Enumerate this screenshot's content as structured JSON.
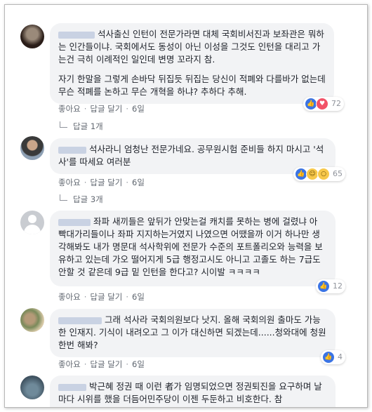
{
  "labels": {
    "like": "좋아요",
    "reply": "답글 달기",
    "sep": "·"
  },
  "comments": [
    {
      "author_name": "",
      "paragraphs": [
        "석사출신 인턴이 전문가라면 대체 국회비서진과 보좌관은 뭐하는 인간들이냐. 국회에서도 동성이 아닌 이성을 그것도 인턴을 대리고 가는건 극히 이례적인 일인데 변명 꼬라지 참.",
        "자기 한말을 그렇게 손바닥 뒤집듯 뒤집는 당신이 적폐와 다를바가 없는데 무슨 적폐를 논하고 무슨 개혁을 하냐? 추하다 추해."
      ],
      "time": "6일",
      "reactions": [
        "like",
        "love"
      ],
      "reaction_count": "72",
      "replies": "답글 1개"
    },
    {
      "author_name": "",
      "paragraphs": [
        "석사라니 엄청난 전문가네요. 공무원시험 준비들 하지 마시고 '석사'를 따세요 여러분"
      ],
      "time": "6일",
      "reactions": [
        "like",
        "haha",
        "wow"
      ],
      "reaction_count": "65",
      "replies": "답글 3개"
    },
    {
      "author_name": "",
      "paragraphs": [
        "좌파 새끼들은 앞뒤가 안맞는걸 캐치를 못하는 병에 걸렸냐 아 빡대가리들이나 좌파 지지하는거였지 나였으면 어땠을까 이거 하나만 생각해봐도 내가 명문대 석사학위에 전문가 수준의 포트폴리오와 능력을 보유하고 있는데 가오 떨어지게 5급 행정고시도 아니고 고졸도 하는 7급도 안할 것 같은데 9급 밑 인턴을 한다고? 시이발 ㅋㅋㅋㅋ"
      ],
      "time": "6일",
      "reactions": [
        "like"
      ],
      "reaction_count": "12",
      "replies": ""
    },
    {
      "author_name": "",
      "paragraphs": [
        "그래 석사라 국회의원보다 낫지. 올해 국회의원 출마도 가능한 인재지. 기식이 내려오고 그 이가 대신하면 되겠는데......청와대에 청원 한번 해봐?"
      ],
      "time": "6일",
      "reactions": [
        "like"
      ],
      "reaction_count": "4",
      "replies": ""
    },
    {
      "author_name": "",
      "paragraphs": [
        "박근혜 정권 때 이런 者가 임명되었으면 정권퇴진을 요구하며 날마다 시위를 했을 더듬어민주당이 이젠 두둔하고 비호한다. 참"
      ],
      "time": "",
      "reactions": [],
      "reaction_count": "",
      "replies": ""
    }
  ]
}
